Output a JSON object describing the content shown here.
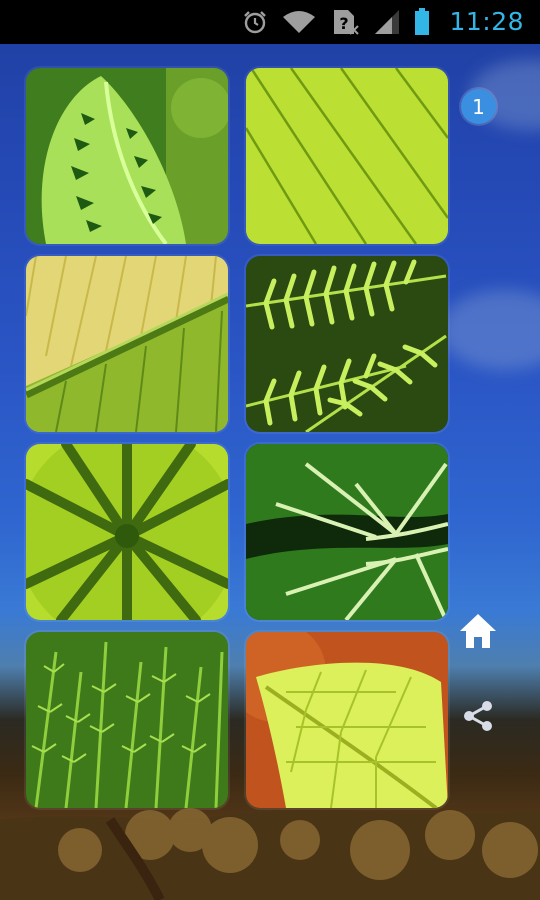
{
  "status_bar": {
    "time": "11:28",
    "icons": [
      "alarm-icon",
      "wifi-icon",
      "no-sim-icon",
      "signal-icon",
      "battery-icon"
    ]
  },
  "gallery": {
    "tiles": [
      {
        "name": "leaf-prayer-plant",
        "icon": "thumbnail"
      },
      {
        "name": "leaf-veins-yellow",
        "icon": "thumbnail"
      },
      {
        "name": "leaf-banana",
        "icon": "thumbnail"
      },
      {
        "name": "leaf-fern-fronds",
        "icon": "thumbnail"
      },
      {
        "name": "leaf-lotus-underside",
        "icon": "thumbnail"
      },
      {
        "name": "leaf-alocasia",
        "icon": "thumbnail"
      },
      {
        "name": "leaf-fern-field",
        "icon": "thumbnail"
      },
      {
        "name": "leaf-yellow-veined",
        "icon": "thumbnail"
      }
    ]
  },
  "sidebar": {
    "badge": "1",
    "home_icon": "home-icon",
    "share_icon": "share-icon"
  },
  "colors": {
    "accent": "#33b5e5",
    "badge": "#3a8fe0"
  }
}
